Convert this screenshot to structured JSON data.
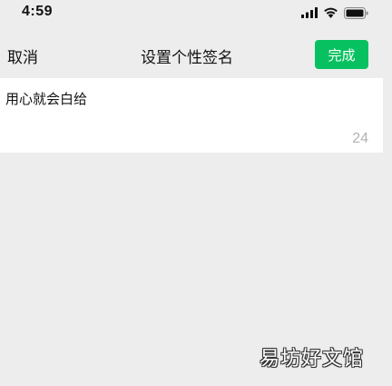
{
  "status_bar": {
    "time": "4:59",
    "icons": [
      "signal-icon",
      "wifi-icon",
      "battery-icon"
    ]
  },
  "nav": {
    "cancel_label": "取消",
    "title": "设置个性签名",
    "done_label": "完成"
  },
  "editor": {
    "value": "用心就会白给",
    "remaining_count": "24"
  },
  "watermark": {
    "text": "易坊好文馆"
  },
  "colors": {
    "accent": "#07c160",
    "background": "#ededed",
    "counter": "#b2b2b2"
  }
}
